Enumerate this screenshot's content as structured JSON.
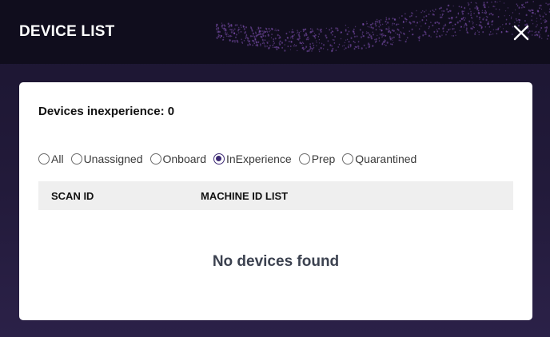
{
  "header": {
    "title": "DEVICE LIST",
    "close_icon": "close-icon"
  },
  "summary": {
    "text": "Devices inexperience: 0"
  },
  "filters": {
    "options": [
      {
        "label": "All",
        "checked": false
      },
      {
        "label": "Unassigned",
        "checked": false
      },
      {
        "label": "Onboard",
        "checked": false
      },
      {
        "label": "InExperience",
        "checked": true
      },
      {
        "label": "Prep",
        "checked": false
      },
      {
        "label": "Quarantined",
        "checked": false
      }
    ]
  },
  "table": {
    "columns": [
      "SCAN ID",
      "MACHINE ID LIST"
    ],
    "rows": [],
    "empty_message": "No devices found"
  },
  "colors": {
    "header_bg": "#100d1d",
    "body_bg": "#221a3a",
    "accent": "#3d2a74",
    "table_header_bg": "#efefef"
  }
}
